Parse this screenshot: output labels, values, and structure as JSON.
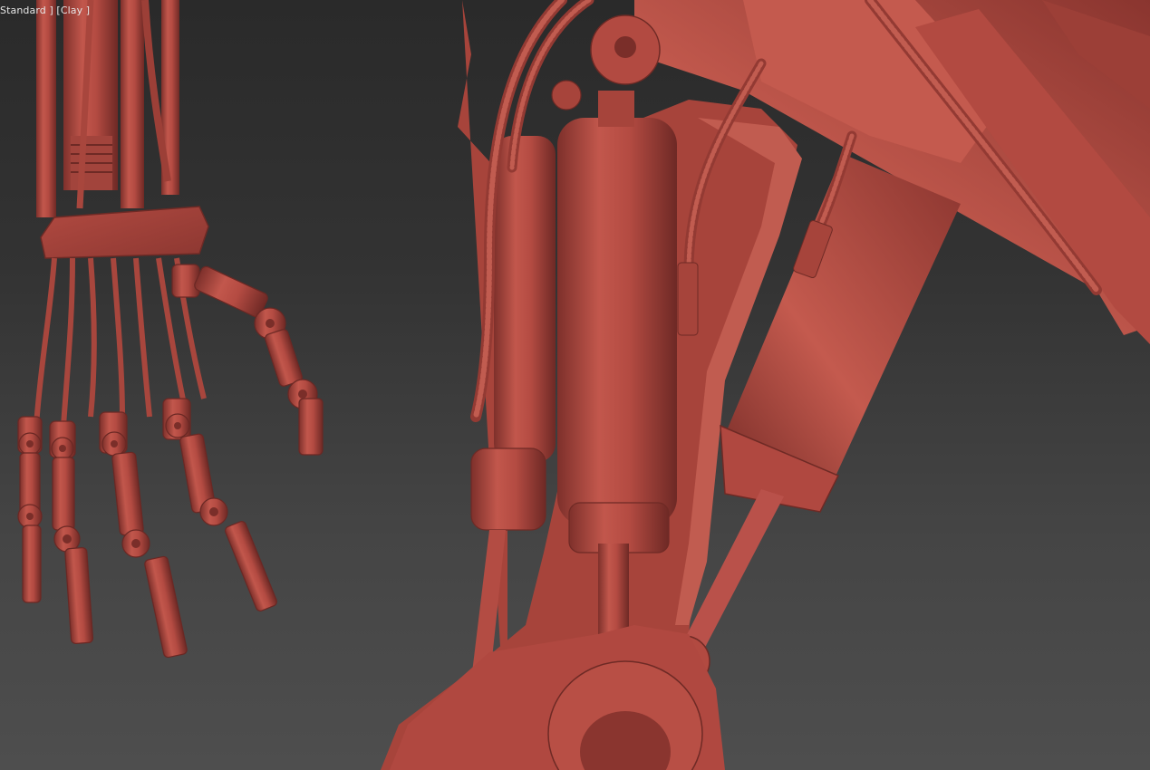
{
  "viewport": {
    "label": "Standard ] [Clay ]",
    "shading_mode": "Clay",
    "render_preset": "Standard",
    "background_top": "#2a2a2a",
    "background_bottom": "#4e4e4e",
    "clay_color": "#b84d44",
    "clay_shadow": "#8a3530",
    "clay_highlight": "#d06a5e"
  },
  "scene": {
    "left_object": "robotic-hand",
    "right_object": "robotic-leg-hydraulics"
  }
}
